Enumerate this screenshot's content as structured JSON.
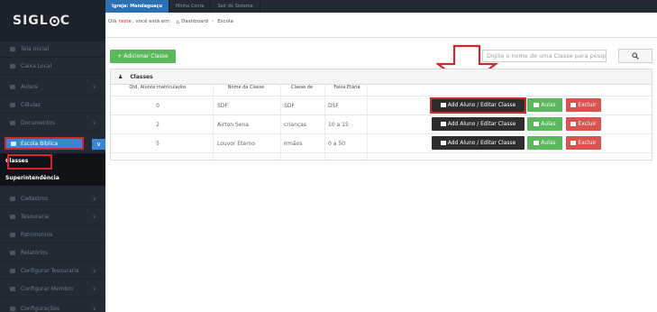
{
  "app": {
    "logo": "SIGL",
    "logo_tail": "C"
  },
  "topbar": {
    "tabs": [
      {
        "label": "Igreja: Mandaguaçu",
        "active": true
      },
      {
        "label": "Minha Conta",
        "active": false
      },
      {
        "label": "Sair do Sistema",
        "active": false
      }
    ]
  },
  "breadcrumb": {
    "prefix": "Olá",
    "user": "teste",
    "suffix": ", você está em:",
    "home": "Dashboard",
    "separator": "›",
    "current": "Escola"
  },
  "sidebar": {
    "items": [
      {
        "label": "Tela Inicial",
        "chevron": ""
      },
      {
        "label": "Caixa Local",
        "chevron": ""
      },
      {
        "label": "Avisos",
        "chevron": "∨"
      },
      {
        "label": "Células",
        "chevron": ""
      },
      {
        "label": "Documentos",
        "chevron": "∨"
      },
      {
        "label": "Cadastros",
        "chevron": "∨"
      },
      {
        "label": "Tesouraria",
        "chevron": "∨"
      },
      {
        "label": "Patrimonios",
        "chevron": ""
      },
      {
        "label": "Relatórios",
        "chevron": ""
      },
      {
        "label": "Configurar Tesouraria",
        "chevron": "∨"
      },
      {
        "label": "Configurar Membro",
        "chevron": "∨"
      },
      {
        "label": "Configurações",
        "chevron": "∨"
      }
    ],
    "active": {
      "label": "Escola Biblica",
      "chevron": "∨"
    },
    "submenu": [
      "Classes",
      "Superintendência"
    ]
  },
  "toolbar": {
    "add_label": "+ Adicionar Classe",
    "search_placeholder": "Digite o nome de uma Classe para pesquisar",
    "search_icon": "search-icon"
  },
  "panel": {
    "title": "Classes"
  },
  "table": {
    "headers": [
      "Qtd. Alunos matriculados",
      "Nome da Classe",
      "Classe de",
      "Faixa Etária"
    ],
    "rows": [
      {
        "qtd": "0",
        "nome": "SDF",
        "classe": "SDF",
        "faixa": "DSF"
      },
      {
        "qtd": "2",
        "nome": "Airton Sena",
        "classe": "crianças",
        "faixa": "10 a 15"
      },
      {
        "qtd": "5",
        "nome": "Louvor Eterno",
        "classe": "Irmãos",
        "faixa": "0 a 50"
      }
    ],
    "actions": {
      "edit": "Add Aluno / Editar Classe",
      "aulas": "Aulas",
      "excluir": "Excluir"
    }
  },
  "colors": {
    "sidebar": "#222a36",
    "active_blue": "#3a86d4",
    "highlight_red": "#d0282e",
    "green": "#5cb85c",
    "danger": "#d9534f"
  }
}
